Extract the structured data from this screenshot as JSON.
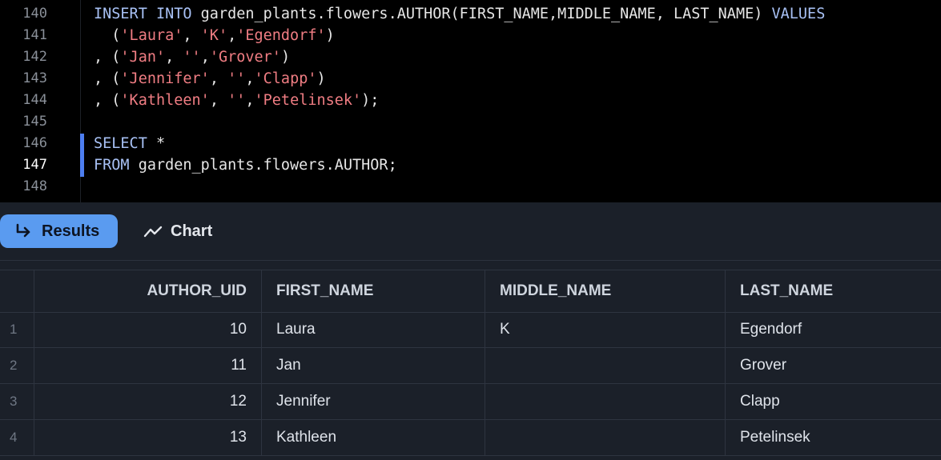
{
  "editor": {
    "line_numbers": [
      "140",
      "141",
      "142",
      "143",
      "144",
      "145",
      "146",
      "147",
      "148"
    ],
    "active_line": "147",
    "lines": [
      [
        {
          "t": "kw",
          "v": "INSERT INTO"
        },
        {
          "t": "plain",
          "v": " garden_plants.flowers.AUTHOR(FIRST_NAME,MIDDLE_NAME, LAST_NAME) "
        },
        {
          "t": "kw",
          "v": "VALUES"
        }
      ],
      [
        {
          "t": "plain",
          "v": "  ("
        },
        {
          "t": "str",
          "v": "'Laura'"
        },
        {
          "t": "plain",
          "v": ", "
        },
        {
          "t": "str",
          "v": "'K'"
        },
        {
          "t": "plain",
          "v": ","
        },
        {
          "t": "str",
          "v": "'Egendorf'"
        },
        {
          "t": "plain",
          "v": ")"
        }
      ],
      [
        {
          "t": "plain",
          "v": ", ("
        },
        {
          "t": "str",
          "v": "'Jan'"
        },
        {
          "t": "plain",
          "v": ", "
        },
        {
          "t": "str",
          "v": "''"
        },
        {
          "t": "plain",
          "v": ","
        },
        {
          "t": "str",
          "v": "'Grover'"
        },
        {
          "t": "plain",
          "v": ")"
        }
      ],
      [
        {
          "t": "plain",
          "v": ", ("
        },
        {
          "t": "str",
          "v": "'Jennifer'"
        },
        {
          "t": "plain",
          "v": ", "
        },
        {
          "t": "str",
          "v": "''"
        },
        {
          "t": "plain",
          "v": ","
        },
        {
          "t": "str",
          "v": "'Clapp'"
        },
        {
          "t": "plain",
          "v": ")"
        }
      ],
      [
        {
          "t": "plain",
          "v": ", ("
        },
        {
          "t": "str",
          "v": "'Kathleen'"
        },
        {
          "t": "plain",
          "v": ", "
        },
        {
          "t": "str",
          "v": "''"
        },
        {
          "t": "plain",
          "v": ","
        },
        {
          "t": "str",
          "v": "'Petelinsek'"
        },
        {
          "t": "plain",
          "v": ");"
        }
      ],
      [],
      [
        {
          "t": "kw",
          "v": "SELECT"
        },
        {
          "t": "plain",
          "v": " *"
        }
      ],
      [
        {
          "t": "kw",
          "v": "FROM"
        },
        {
          "t": "plain",
          "v": " garden_plants.flowers.AUTHOR;"
        }
      ],
      []
    ]
  },
  "toolbar": {
    "results_label": "Results",
    "chart_label": "Chart"
  },
  "results": {
    "columns": [
      "AUTHOR_UID",
      "FIRST_NAME",
      "MIDDLE_NAME",
      "LAST_NAME"
    ],
    "rows": [
      {
        "index": "1",
        "author_uid": "10",
        "first_name": "Laura",
        "middle_name": "K",
        "last_name": "Egendorf"
      },
      {
        "index": "2",
        "author_uid": "11",
        "first_name": "Jan",
        "middle_name": "",
        "last_name": "Grover"
      },
      {
        "index": "3",
        "author_uid": "12",
        "first_name": "Jennifer",
        "middle_name": "",
        "last_name": "Clapp"
      },
      {
        "index": "4",
        "author_uid": "13",
        "first_name": "Kathleen",
        "middle_name": "",
        "last_name": "Petelinsek"
      }
    ]
  },
  "colors": {
    "keyword": "#a8c1f5",
    "string": "#f07d83",
    "accent": "#5a9bf0"
  }
}
